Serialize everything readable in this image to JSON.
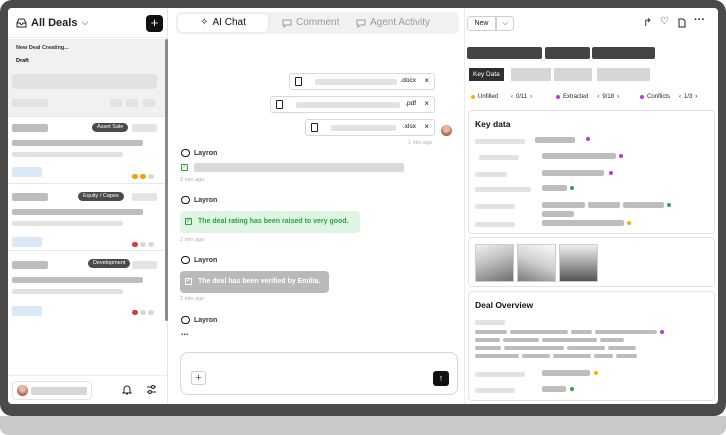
{
  "sidebar": {
    "title": "All Deals",
    "new_deal_label": "New Deal Creating...",
    "draft_label": "Draft",
    "deal_tags": [
      "Asset Sale",
      "Equity / Capex",
      "Development"
    ]
  },
  "chat": {
    "tabs": [
      {
        "label": "AI Chat",
        "icon": "sparkle-icon"
      },
      {
        "label": "Comment",
        "icon": "comment-icon"
      },
      {
        "label": "Agent Activity",
        "icon": "chat-bubble-icon"
      }
    ],
    "files": [
      ".docx",
      ".pdf",
      ".xlsx"
    ],
    "upload_time": "1 min ago",
    "agent_name": "Layron",
    "messages": [
      {
        "agent": "Layron",
        "text": "",
        "time": "2 min ago"
      },
      {
        "agent": "Layron",
        "text": "The deal rating has been raised to very good.",
        "time": "2 min ago"
      },
      {
        "agent": "Layron",
        "text": "The deal has been verified by Emilia.",
        "time": "2 min ago"
      },
      {
        "agent": "Layron",
        "typing": "..."
      }
    ]
  },
  "panel": {
    "new_button": "New",
    "active_tab": "Key Data",
    "status": {
      "unfilled_label": "Unfilled",
      "unfilled_count": "0/11",
      "extracted_label": "Extracted",
      "extracted_count": "9/18",
      "conflicts_label": "Conflicts",
      "conflicts_count": "1/3"
    },
    "key_data_title": "Key data",
    "deal_overview_title": "Deal Overview",
    "colors": {
      "unfilled": "#f0b400",
      "extracted": "#b23fd4",
      "conflicts": "#b23fd4",
      "green": "#2aa84a",
      "red": "#d93a3a"
    }
  }
}
